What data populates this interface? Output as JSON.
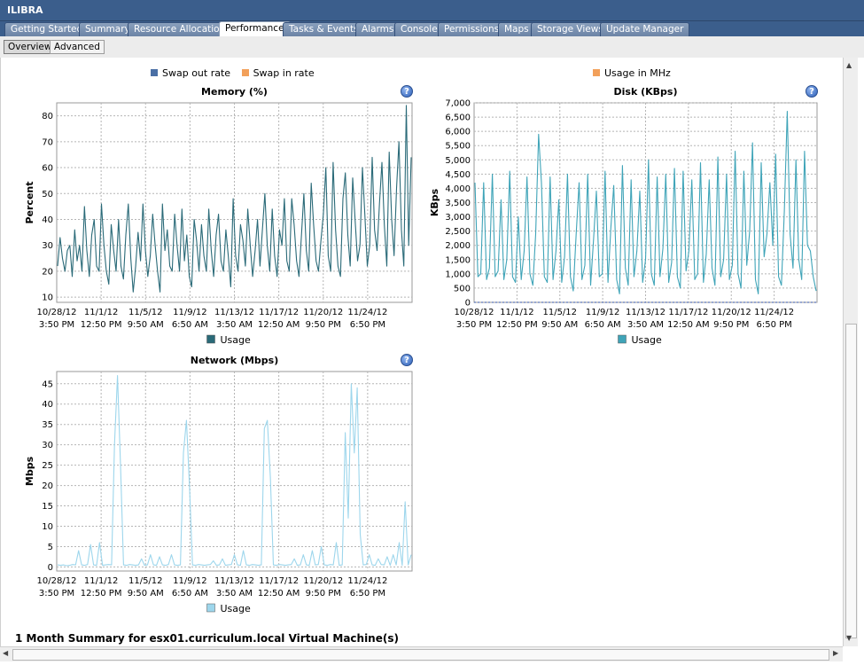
{
  "window": {
    "title": "ILIBRA"
  },
  "tabs": [
    {
      "label": "Getting Started",
      "active": false
    },
    {
      "label": "Summary",
      "active": false
    },
    {
      "label": "Resource Allocation",
      "active": false
    },
    {
      "label": "Performance",
      "active": true
    },
    {
      "label": "Tasks & Events",
      "active": false
    },
    {
      "label": "Alarms",
      "active": false
    },
    {
      "label": "Console",
      "active": false
    },
    {
      "label": "Permissions",
      "active": false
    },
    {
      "label": "Maps",
      "active": false
    },
    {
      "label": "Storage Views",
      "active": false
    },
    {
      "label": "Update Manager",
      "active": false
    }
  ],
  "subtabs": [
    {
      "label": "Overview",
      "active": true
    },
    {
      "label": "Advanced",
      "active": false
    }
  ],
  "legends_top": {
    "left": [
      {
        "label": "Swap out rate",
        "color": "#4a6fa5"
      },
      {
        "label": "Swap in rate",
        "color": "#f2a05a"
      }
    ],
    "right": [
      {
        "label": "Usage in MHz",
        "color": "#f2a05a"
      }
    ]
  },
  "help_label": "?",
  "footer_title": "1 Month Summary for esx01.curriculum.local Virtual Machine(s)",
  "chart_data": [
    {
      "type": "line",
      "title": "Memory (%)",
      "ylabel": "Percent",
      "ylim": [
        8,
        85
      ],
      "yticks": [
        10,
        20,
        30,
        40,
        50,
        60,
        70,
        80
      ],
      "ytick_labels": [
        "10",
        "20",
        "30",
        "40",
        "50",
        "60",
        "70",
        "80"
      ],
      "x": [
        "10/28/12 3:50 PM",
        "11/1/12 12:50 PM",
        "11/5/12 9:50 AM",
        "11/9/12 6:50 AM",
        "11/13/12 3:50 AM",
        "11/17/12 12:50 AM",
        "11/20/12 9:50 PM",
        "11/24/12 6:50 PM"
      ],
      "xtick_labels": [
        [
          "10/28/12",
          "3:50 PM"
        ],
        [
          "11/1/12",
          "12:50 PM"
        ],
        [
          "11/5/12",
          "9:50 AM"
        ],
        [
          "11/9/12",
          "6:50 AM"
        ],
        [
          "11/13/12",
          "3:50 AM"
        ],
        [
          "11/17/12",
          "12:50 AM"
        ],
        [
          "11/20/12",
          "9:50 PM"
        ],
        [
          "11/24/12",
          "6:50 PM"
        ]
      ],
      "series": [
        {
          "name": "Usage",
          "color": "#2a6a78",
          "values": [
            22,
            33,
            25,
            20,
            28,
            30,
            18,
            36,
            24,
            30,
            20,
            45,
            28,
            18,
            34,
            40,
            22,
            20,
            46,
            30,
            20,
            15,
            38,
            28,
            20,
            40,
            22,
            17,
            34,
            46,
            25,
            12,
            22,
            35,
            24,
            46,
            28,
            18,
            26,
            42,
            30,
            20,
            12,
            46,
            28,
            36,
            22,
            20,
            42,
            30,
            20,
            44,
            24,
            34,
            18,
            14,
            40,
            32,
            20,
            38,
            26,
            20,
            44,
            28,
            18,
            34,
            42,
            24,
            20,
            36,
            26,
            14,
            48,
            26,
            20,
            38,
            32,
            22,
            44,
            30,
            18,
            28,
            40,
            22,
            36,
            50,
            30,
            20,
            44,
            26,
            18,
            36,
            30,
            48,
            24,
            20,
            48,
            38,
            24,
            18,
            34,
            50,
            28,
            20,
            54,
            38,
            24,
            20,
            32,
            42,
            60,
            26,
            20,
            62,
            36,
            22,
            18,
            48,
            58,
            34,
            22,
            56,
            40,
            24,
            30,
            60,
            42,
            22,
            30,
            64,
            36,
            28,
            46,
            62,
            38,
            22,
            66,
            40,
            26,
            52,
            70,
            36,
            22,
            84,
            30,
            64
          ]
        }
      ],
      "legend": "bottom",
      "grid": true
    },
    {
      "type": "line",
      "title": "Disk (KBps)",
      "ylabel": "KBps",
      "ylim": [
        0,
        7000
      ],
      "yticks": [
        0,
        500,
        1000,
        1500,
        2000,
        2500,
        3000,
        3500,
        4000,
        4500,
        5000,
        5500,
        6000,
        6500,
        7000
      ],
      "ytick_labels": [
        "0",
        "500",
        "1,000",
        "1,500",
        "2,000",
        "2,500",
        "3,000",
        "3,500",
        "4,000",
        "4,500",
        "5,000",
        "5,500",
        "6,000",
        "6,500",
        "7,000"
      ],
      "x": [
        "10/28/12 3:50 PM",
        "11/1/12 12:50 PM",
        "11/5/12 9:50 AM",
        "11/9/12 6:50 AM",
        "11/13/12 3:50 AM",
        "11/17/12 12:50 AM",
        "11/20/12 9:50 PM",
        "11/24/12 6:50 PM"
      ],
      "xtick_labels": [
        [
          "10/28/12",
          "3:50 PM"
        ],
        [
          "11/1/12",
          "12:50 PM"
        ],
        [
          "11/5/12",
          "9:50 AM"
        ],
        [
          "11/9/12",
          "6:50 AM"
        ],
        [
          "11/13/12",
          "3:50 AM"
        ],
        [
          "11/17/12",
          "12:50 AM"
        ],
        [
          "11/20/12",
          "9:50 PM"
        ],
        [
          "11/24/12",
          "6:50 PM"
        ]
      ],
      "series": [
        {
          "name": "Usage",
          "color": "#3fa4b8",
          "values": [
            4200,
            900,
            1000,
            4200,
            800,
            1200,
            4500,
            900,
            1100,
            3600,
            800,
            1500,
            4600,
            900,
            700,
            3000,
            800,
            1800,
            4400,
            1000,
            600,
            2400,
            5900,
            4200,
            900,
            700,
            4400,
            800,
            1800,
            3600,
            700,
            1600,
            4500,
            900,
            400,
            2400,
            4200,
            800,
            1300,
            4500,
            600,
            2200,
            3900,
            900,
            1000,
            4600,
            700,
            2600,
            4100,
            800,
            300,
            4800,
            1200,
            600,
            4300,
            900,
            1800,
            3900,
            700,
            1500,
            5000,
            1000,
            600,
            4400,
            900,
            1900,
            4500,
            700,
            1400,
            4700,
            900,
            500,
            4600,
            1100,
            1800,
            4300,
            800,
            1000,
            4900,
            700,
            1700,
            4300,
            1200,
            600,
            5100,
            900,
            1500,
            4500,
            800,
            1300,
            5300,
            1000,
            500,
            4600,
            1300,
            2500,
            5600,
            800,
            300,
            4900,
            1600,
            2400,
            4200,
            2000,
            5200,
            900,
            600,
            3200,
            6700,
            2400,
            1200,
            5000,
            1500,
            800,
            5300,
            2000,
            1800,
            900,
            400
          ]
        }
      ],
      "legend": "bottom",
      "grid": true
    },
    {
      "type": "line",
      "title": "Network (Mbps)",
      "ylabel": "Mbps",
      "ylim": [
        -1,
        48
      ],
      "yticks": [
        0,
        5,
        10,
        15,
        20,
        25,
        30,
        35,
        40,
        45
      ],
      "ytick_labels": [
        "0",
        "5",
        "10",
        "15",
        "20",
        "25",
        "30",
        "35",
        "40",
        "45"
      ],
      "x": [
        "10/28/12 3:50 PM",
        "11/1/12 12:50 PM",
        "11/5/12 9:50 AM",
        "11/9/12 6:50 AM",
        "11/13/12 3:50 AM",
        "11/17/12 12:50 AM",
        "11/20/12 9:50 PM",
        "11/24/12 6:50 PM"
      ],
      "xtick_labels": [
        [
          "10/28/12",
          "3:50 PM"
        ],
        [
          "11/1/12",
          "12:50 PM"
        ],
        [
          "11/5/12",
          "9:50 AM"
        ],
        [
          "11/9/12",
          "6:50 AM"
        ],
        [
          "11/13/12",
          "3:50 AM"
        ],
        [
          "11/17/12",
          "12:50 AM"
        ],
        [
          "11/20/12",
          "9:50 PM"
        ],
        [
          "11/24/12",
          "6:50 PM"
        ]
      ],
      "series": [
        {
          "name": "Usage",
          "color": "#9dd6ec",
          "values": [
            0.5,
            0.4,
            0.5,
            0.3,
            0.4,
            0.6,
            0.5,
            4,
            0.5,
            0.4,
            0.6,
            5.5,
            0.5,
            0.4,
            6,
            0.4,
            0.5,
            0.6,
            0.5,
            30,
            47,
            25,
            0.5,
            0.4,
            0.6,
            0.5,
            0.4,
            0.5,
            2,
            0.4,
            0.5,
            3,
            0.5,
            0.4,
            2.5,
            0.5,
            0.4,
            0.6,
            3,
            0.5,
            0.4,
            0.5,
            28,
            36,
            20,
            0.5,
            0.4,
            0.6,
            0.5,
            0.4,
            0.5,
            0.6,
            1.5,
            0.4,
            0.5,
            2,
            0.4,
            0.5,
            0.6,
            3,
            0.5,
            0.4,
            4,
            0.5,
            0.4,
            0.6,
            0.5,
            0.4,
            0.5,
            34,
            36,
            22,
            0.5,
            0.4,
            0.6,
            0.5,
            0.4,
            0.5,
            0.6,
            2,
            0.4,
            0.5,
            3,
            0.5,
            0.4,
            4,
            0.5,
            0.6,
            5,
            0.5,
            0.4,
            0.6,
            0.5,
            6,
            0.4,
            0.5,
            33,
            12,
            45,
            28,
            44,
            8,
            0.5,
            0.6,
            3,
            0.5,
            0.4,
            2,
            0.6,
            0.5,
            2.5,
            0.4,
            3,
            0.5,
            6,
            0.4,
            16,
            0.5,
            3
          ]
        }
      ],
      "legend": "bottom",
      "grid": true
    }
  ]
}
